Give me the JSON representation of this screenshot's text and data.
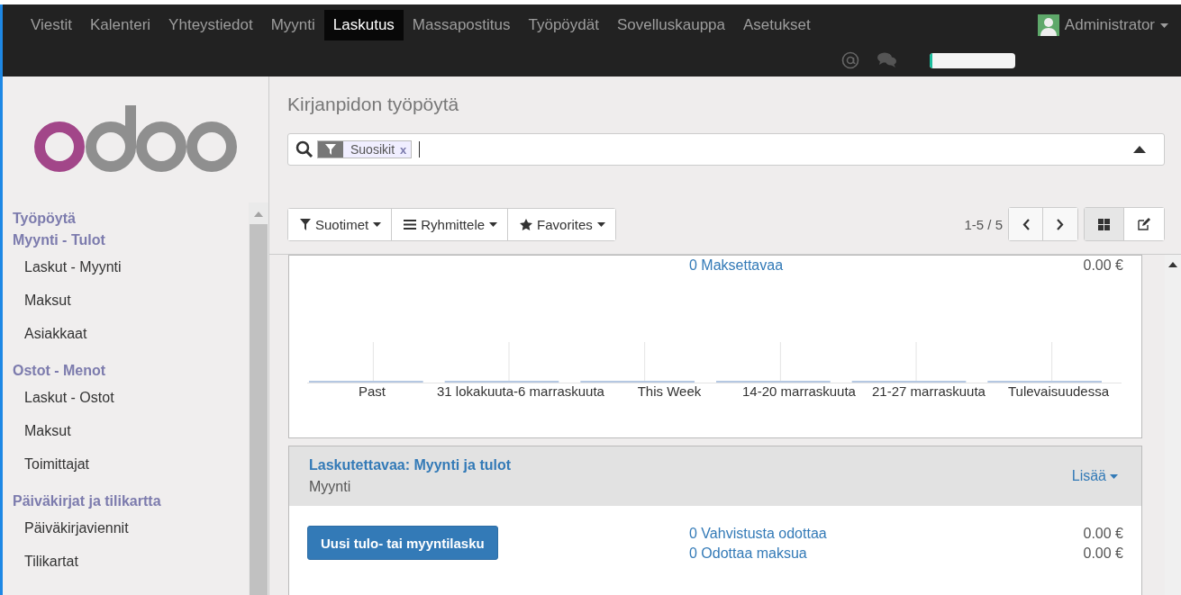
{
  "topbar": {
    "menu": [
      {
        "label": "Viestit",
        "selected": false
      },
      {
        "label": "Kalenteri",
        "selected": false
      },
      {
        "label": "Yhteystiedot",
        "selected": false
      },
      {
        "label": "Myynti",
        "selected": false
      },
      {
        "label": "Laskutus",
        "selected": true
      },
      {
        "label": "Massapostitus",
        "selected": false
      },
      {
        "label": "Työpöydät",
        "selected": false
      },
      {
        "label": "Sovelluskauppa",
        "selected": false
      },
      {
        "label": "Asetukset",
        "selected": false
      }
    ],
    "user": "Administrator",
    "progress": {
      "level": 0.03
    }
  },
  "sidebar": {
    "items": [
      {
        "kind": "header",
        "label": "Työpöytä"
      },
      {
        "kind": "header",
        "label": "Myynti - Tulot"
      },
      {
        "kind": "item",
        "label": "Laskut - Myynti"
      },
      {
        "kind": "item",
        "label": "Maksut"
      },
      {
        "kind": "item",
        "label": "Asiakkaat"
      },
      {
        "kind": "header",
        "label": "Ostot - Menot"
      },
      {
        "kind": "item",
        "label": "Laskut - Ostot"
      },
      {
        "kind": "item",
        "label": "Maksut"
      },
      {
        "kind": "item",
        "label": "Toimittajat"
      },
      {
        "kind": "header",
        "label": "Päiväkirjat ja tilikartta"
      },
      {
        "kind": "item",
        "label": "Päiväkirjaviennit"
      },
      {
        "kind": "item",
        "label": "Tilikartat"
      }
    ]
  },
  "title": "Kirjanpidon työpöytä",
  "search": {
    "facet": "Suosikit",
    "remove": "x"
  },
  "toolbar": {
    "buttons": [
      {
        "kind": "filter",
        "label": "Suotimet"
      },
      {
        "kind": "group",
        "label": "Ryhmittele"
      },
      {
        "kind": "star",
        "label": "Favorites"
      }
    ],
    "pager": "1-5 / 5",
    "views": [
      {
        "kind": "kanban",
        "selected": true
      },
      {
        "kind": "form",
        "selected": false
      }
    ]
  },
  "card1": {
    "link": "0 Maksettavaa",
    "amount": "0.00 €",
    "chart": {
      "categories": [
        "Past",
        "31 lokakuuta-6 marraskuuta",
        "This Week",
        "14-20 marraskuuta",
        "21-27 marraskuuta",
        "Tulevaisuudessa"
      ]
    }
  },
  "card2": {
    "title": "Laskutettavaa: Myynti ja tulot",
    "subtitle": "Myynti",
    "more": "Lisää",
    "button": "Uusi tulo- tai myyntilasku",
    "rows": [
      {
        "link": "0 Vahvistusta odottaa",
        "amount": "0.00 €"
      },
      {
        "link": "0 Odottaa maksua",
        "amount": "0.00 €"
      }
    ]
  }
}
